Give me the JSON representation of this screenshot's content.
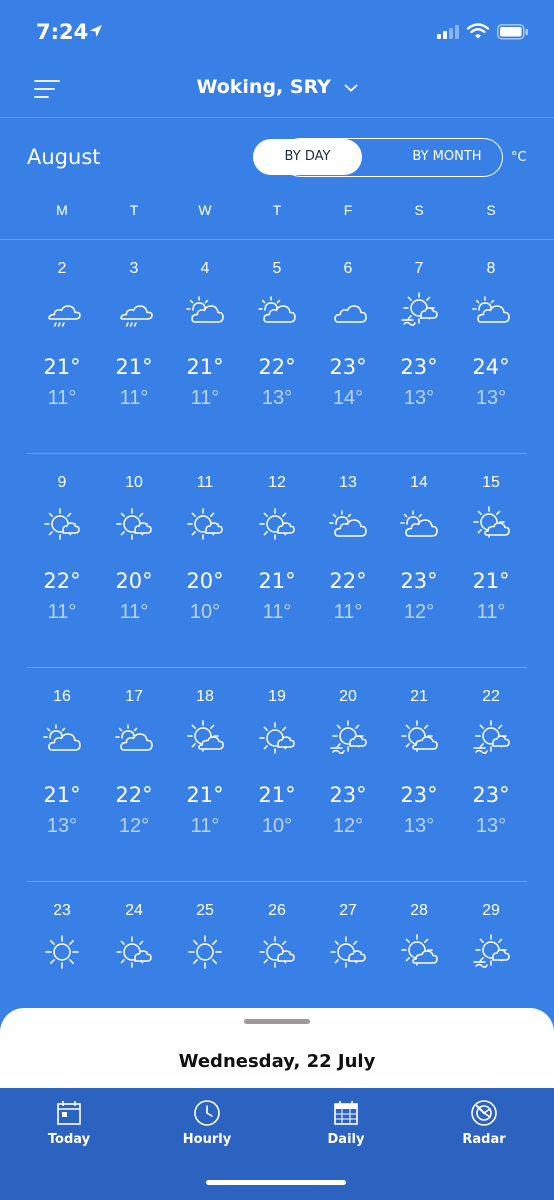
{
  "status_bar": {
    "time": "7:24"
  },
  "header": {
    "location": "Woking, SRY"
  },
  "calendar": {
    "month": "August",
    "toggle": {
      "by_day": "BY DAY",
      "by_month": "BY MONTH",
      "selected": "BY DAY"
    },
    "unit": "°C",
    "weekdays": [
      "M",
      "T",
      "W",
      "T",
      "F",
      "S",
      "S"
    ],
    "weeks": [
      [
        {
          "day": "2",
          "icon": "rain-icon",
          "high": "21°",
          "low": "11°"
        },
        {
          "day": "3",
          "icon": "rain-icon",
          "high": "21°",
          "low": "11°"
        },
        {
          "day": "4",
          "icon": "partly-cloudy-icon",
          "high": "21°",
          "low": "11°"
        },
        {
          "day": "5",
          "icon": "partly-cloudy-icon",
          "high": "22°",
          "low": "13°"
        },
        {
          "day": "6",
          "icon": "cloud-icon",
          "high": "23°",
          "low": "14°"
        },
        {
          "day": "7",
          "icon": "sun-cloud-haze-icon",
          "high": "23°",
          "low": "13°"
        },
        {
          "day": "8",
          "icon": "partly-cloudy-icon",
          "high": "24°",
          "low": "13°"
        }
      ],
      [
        {
          "day": "9",
          "icon": "sunny-intervals-icon",
          "high": "22°",
          "low": "11°"
        },
        {
          "day": "10",
          "icon": "sunny-intervals-icon",
          "high": "20°",
          "low": "11°"
        },
        {
          "day": "11",
          "icon": "sunny-intervals-icon",
          "high": "20°",
          "low": "10°"
        },
        {
          "day": "12",
          "icon": "sunny-intervals-icon",
          "high": "21°",
          "low": "11°"
        },
        {
          "day": "13",
          "icon": "partly-cloudy-icon",
          "high": "22°",
          "low": "11°"
        },
        {
          "day": "14",
          "icon": "partly-cloudy-icon",
          "high": "23°",
          "low": "12°"
        },
        {
          "day": "15",
          "icon": "sun-behind-cloud-icon",
          "high": "21°",
          "low": "11°"
        }
      ],
      [
        {
          "day": "16",
          "icon": "partly-cloudy-icon",
          "high": "21°",
          "low": "13°"
        },
        {
          "day": "17",
          "icon": "partly-cloudy-icon",
          "high": "22°",
          "low": "12°"
        },
        {
          "day": "18",
          "icon": "sun-behind-cloud-icon",
          "high": "21°",
          "low": "11°"
        },
        {
          "day": "19",
          "icon": "sunny-intervals-icon",
          "high": "21°",
          "low": "10°"
        },
        {
          "day": "20",
          "icon": "sun-cloud-haze-icon",
          "high": "23°",
          "low": "12°"
        },
        {
          "day": "21",
          "icon": "sun-behind-cloud-icon",
          "high": "23°",
          "low": "13°"
        },
        {
          "day": "22",
          "icon": "sun-cloud-haze-icon",
          "high": "23°",
          "low": "13°"
        }
      ],
      [
        {
          "day": "23",
          "icon": "sun-icon",
          "high": "",
          "low": ""
        },
        {
          "day": "24",
          "icon": "sunny-intervals-icon",
          "high": "",
          "low": ""
        },
        {
          "day": "25",
          "icon": "sun-icon",
          "high": "",
          "low": ""
        },
        {
          "day": "26",
          "icon": "sunny-intervals-icon",
          "high": "",
          "low": ""
        },
        {
          "day": "27",
          "icon": "sunny-intervals-icon",
          "high": "",
          "low": ""
        },
        {
          "day": "28",
          "icon": "sun-behind-cloud-icon",
          "high": "",
          "low": ""
        },
        {
          "day": "29",
          "icon": "sun-cloud-haze-icon",
          "high": "",
          "low": ""
        }
      ]
    ]
  },
  "sheet": {
    "title": "Wednesday, 22 July"
  },
  "tabs": [
    {
      "label": "Today",
      "icon": "calendar-today-icon"
    },
    {
      "label": "Hourly",
      "icon": "clock-icon"
    },
    {
      "label": "Daily",
      "icon": "calendar-daily-icon"
    },
    {
      "label": "Radar",
      "icon": "radar-icon"
    }
  ]
}
